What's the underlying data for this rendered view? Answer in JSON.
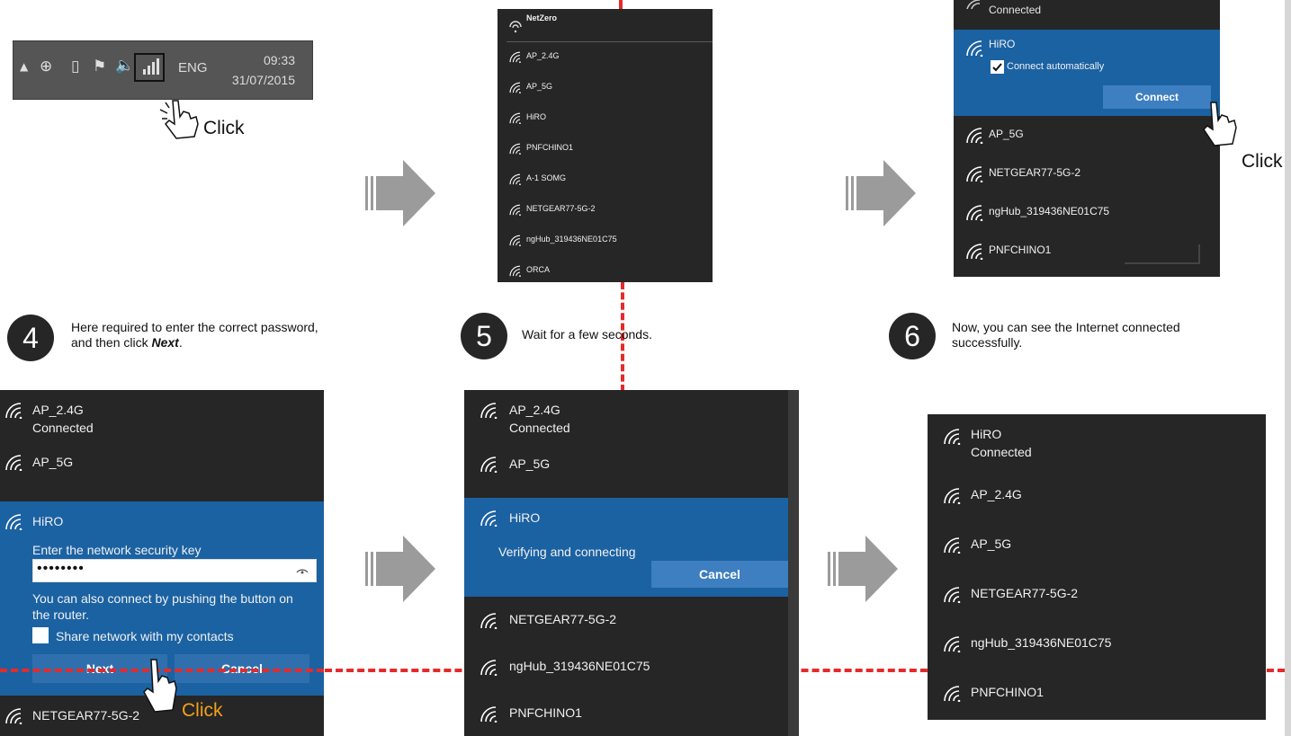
{
  "colors": {
    "panel": "#262626",
    "accent": "#1b62a3",
    "button": "#3d7fc1",
    "guide": "#e52a2a",
    "click_highlight": "#f2a11a"
  },
  "step1": {
    "taskbar": {
      "language": "ENG",
      "time": "09:33",
      "date": "31/07/2015"
    },
    "click": "Click"
  },
  "step2": {
    "header": "NetZero",
    "networks": [
      "AP_2.4G",
      "AP_5G",
      "HiRO",
      "PNFCHINO1",
      "A-1 SOMG",
      "NETGEAR77-5G-2",
      "ngHub_319436NE01C75",
      "ORCA"
    ]
  },
  "step3": {
    "connected_status": "Connected",
    "selected": {
      "name": "HiRO",
      "auto_label": "Connect automatically",
      "connect_button": "Connect"
    },
    "networks": [
      "AP_5G",
      "NETGEAR77-5G-2",
      "ngHub_319436NE01C75",
      "PNFCHINO1"
    ],
    "click": "Click"
  },
  "step4": {
    "number": "4",
    "instruction_pre": "Here required to enter the correct password,",
    "instruction_line2_pre": "and then click ",
    "instruction_emph": "Next",
    "instruction_post": ".",
    "top": {
      "name": "AP_2.4G",
      "status": "Connected"
    },
    "second": "AP_5G",
    "selected": {
      "name": "HiRO",
      "prompt": "Enter the network security key",
      "password": "••••••••",
      "hint_line1": "You can also connect by pushing the button on",
      "hint_line2": "the router.",
      "share_label": "Share network with my contacts",
      "next_button": "Next",
      "cancel_button": "Cancel"
    },
    "bottom": "NETGEAR77-5G-2",
    "click": "Click"
  },
  "step5": {
    "number": "5",
    "instruction": "Wait for a few seconds.",
    "top": {
      "name": "AP_2.4G",
      "status": "Connected"
    },
    "second": "AP_5G",
    "selected": {
      "name": "HiRO",
      "status": "Verifying and connecting",
      "cancel_button": "Cancel"
    },
    "networks": [
      "NETGEAR77-5G-2",
      "ngHub_319436NE01C75",
      "PNFCHINO1"
    ]
  },
  "step6": {
    "number": "6",
    "instruction_line1": "Now, you can see the Internet connected",
    "instruction_line2": "successfully.",
    "top": {
      "name": "HiRO",
      "status": "Connected"
    },
    "networks": [
      "AP_2.4G",
      "AP_5G",
      "NETGEAR77-5G-2",
      "ngHub_319436NE01C75",
      "PNFCHINO1"
    ]
  }
}
